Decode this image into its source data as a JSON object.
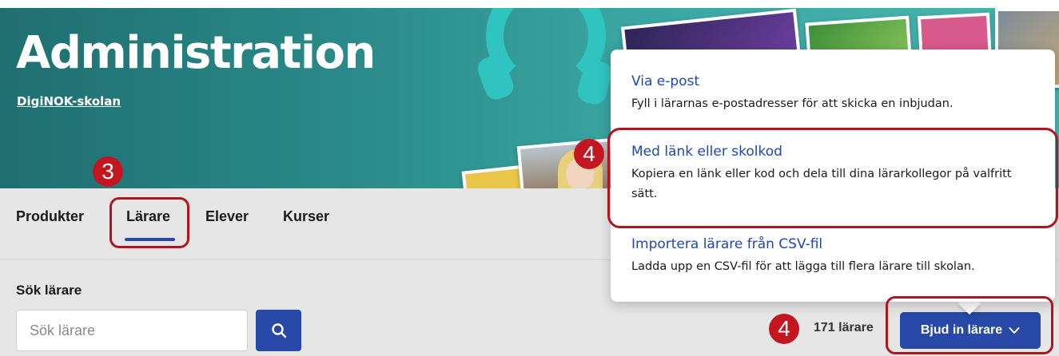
{
  "header": {
    "title": "Administration",
    "school_link": "DigiNOK-skolan"
  },
  "tabs": [
    {
      "label": "Produkter",
      "active": false
    },
    {
      "label": "Lärare",
      "active": true
    },
    {
      "label": "Elever",
      "active": false
    },
    {
      "label": "Kurser",
      "active": false
    }
  ],
  "search": {
    "heading": "Sök lärare",
    "placeholder": "Sök lärare",
    "button_icon": "search-icon"
  },
  "teacher_count": "171 lärare",
  "invite_button": {
    "label": "Bjud in lärare",
    "icon": "chevron-down-icon"
  },
  "invite_menu": [
    {
      "title": "Via e-post",
      "description": "Fyll i lärarnas e-postadresser för att skicka en inbjudan."
    },
    {
      "title": "Med länk eller skolkod",
      "description": "Kopiera en länk eller kod och dela till dina lärarkollegor på valfritt sätt."
    },
    {
      "title": "Importera lärare från CSV-fil",
      "description": "Ladda upp en CSV-fil för att lägga till flera lärare till skolan."
    }
  ],
  "annotations": {
    "step_tab": "3",
    "step_menu": "4",
    "step_button": "4"
  },
  "colors": {
    "accent": "#2849a8",
    "link": "#1f47b2",
    "annotation": "#c41620",
    "hero": "#2b8c8b"
  }
}
